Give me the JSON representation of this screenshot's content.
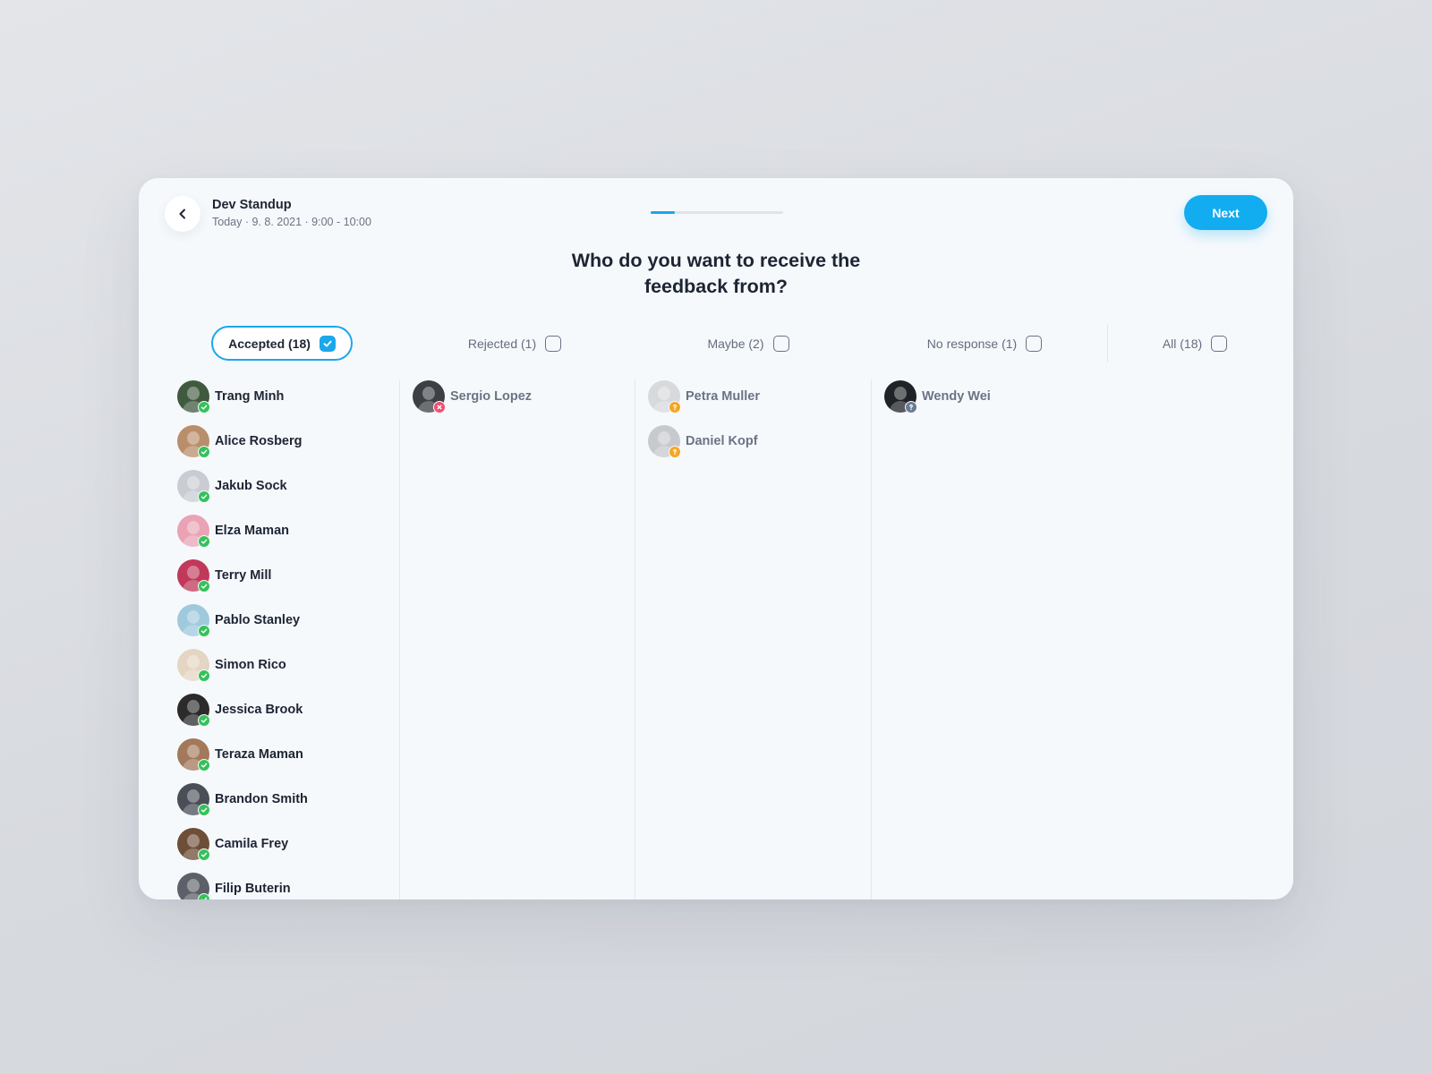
{
  "header": {
    "event_title": "Dev Standup",
    "event_subtitle": "Today · 9. 8. 2021 · 9:00 - 10:00",
    "progress_percent": 18,
    "next_label": "Next"
  },
  "question": "Who do you want to receive the feedback from?",
  "filters": [
    {
      "label": "Accepted (18)",
      "checked": true
    },
    {
      "label": "Rejected (1)",
      "checked": false
    },
    {
      "label": "Maybe (2)",
      "checked": false
    },
    {
      "label": "No response (1)",
      "checked": false
    },
    {
      "label": "All (18)",
      "checked": false
    }
  ],
  "colors": {
    "accent": "#1aa7ec",
    "accepted": "#34c25a",
    "rejected": "#f0506e",
    "maybe": "#f5a623",
    "no_response": "#6b7a94"
  },
  "columns": {
    "accepted": [
      {
        "name": "Trang Minh",
        "avatar": "#3f5a3e"
      },
      {
        "name": "Alice Rosberg",
        "avatar": "#b98e6a"
      },
      {
        "name": "Jakub Sock",
        "avatar": "#c9cdd3"
      },
      {
        "name": "Elza Maman",
        "avatar": "#e9a3b4"
      },
      {
        "name": "Terry Mill",
        "avatar": "#c0395a"
      },
      {
        "name": "Pablo Stanley",
        "avatar": "#9fc9dd"
      },
      {
        "name": "Simon Rico",
        "avatar": "#e4d6c2"
      },
      {
        "name": "Jessica Brook",
        "avatar": "#2c2a2a"
      },
      {
        "name": "Teraza Maman",
        "avatar": "#a2795a"
      },
      {
        "name": "Brandon Smith",
        "avatar": "#4a4f57"
      },
      {
        "name": "Camila Frey",
        "avatar": "#6d4e36"
      },
      {
        "name": "Filip Buterin",
        "avatar": "#5c6068"
      }
    ],
    "rejected": [
      {
        "name": "Sergio Lopez",
        "avatar": "#3c3f44"
      }
    ],
    "maybe": [
      {
        "name": "Petra Muller",
        "avatar": "#d7d9dc"
      },
      {
        "name": "Daniel Kopf",
        "avatar": "#c7c9cc"
      }
    ],
    "no_response": [
      {
        "name": "Wendy Wei",
        "avatar": "#1f2226"
      }
    ]
  }
}
